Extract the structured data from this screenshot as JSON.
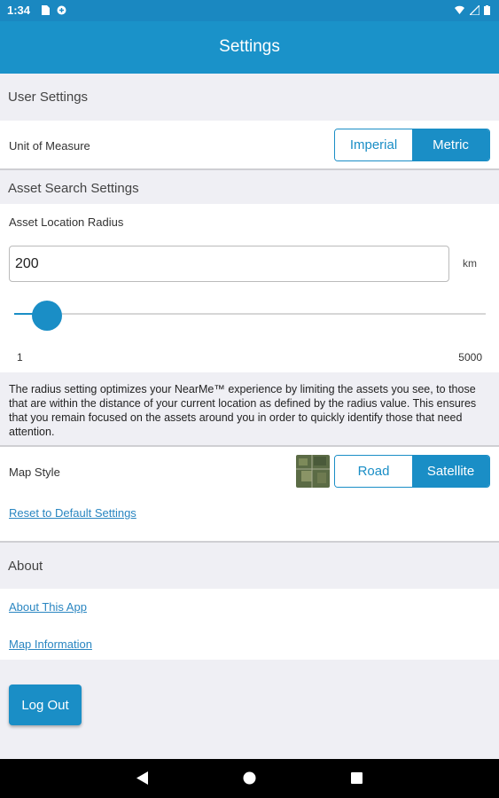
{
  "status_bar": {
    "time": "1:34",
    "color": "#1a88c1"
  },
  "header": {
    "title": "Settings",
    "color": "#1a92c9"
  },
  "user_settings": {
    "header": "User Settings",
    "unit_label": "Unit of Measure",
    "unit_options": [
      "Imperial",
      "Metric"
    ],
    "unit_selected": "Metric"
  },
  "asset_search": {
    "header": "Asset Search Settings",
    "radius_label": "Asset Location Radius",
    "radius_value": "200",
    "radius_unit": "km",
    "slider_min": "1",
    "slider_max": "5000",
    "slider_fraction": 0.04,
    "description": "The radius setting optimizes your NearMe™ experience by limiting the assets you see, to those that are within the distance of your current location as defined by the radius value. This ensures that you remain focused on the assets around you in order to quickly identify those that need attention."
  },
  "map_style": {
    "label": "Map Style",
    "options": [
      "Road",
      "Satellite"
    ],
    "selected": "Satellite",
    "reset_link": "Reset to Default Settings"
  },
  "about": {
    "header": "About",
    "links": [
      "About This App",
      "Map Information"
    ]
  },
  "logout_label": "Log Out",
  "accent_color": "#1a8ec6"
}
